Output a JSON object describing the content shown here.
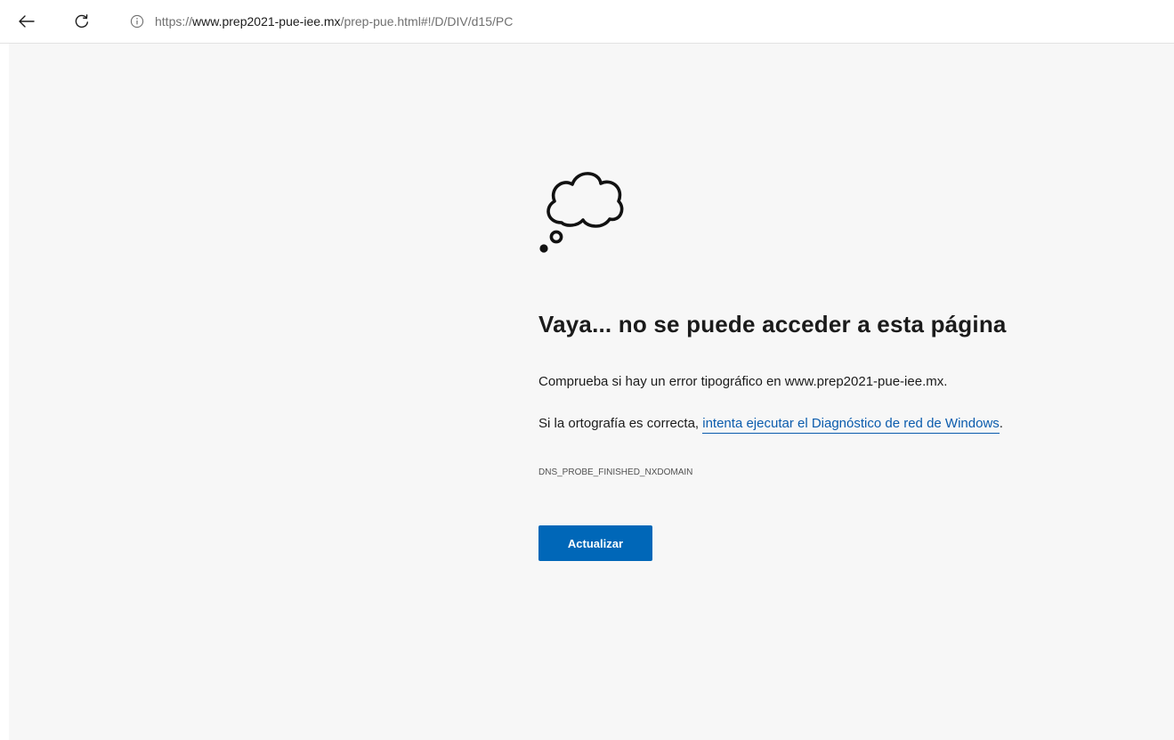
{
  "browser": {
    "back_icon": "arrow-left-icon",
    "refresh_icon": "refresh-icon",
    "info_icon": "info-icon",
    "url": {
      "scheme": "https://",
      "host": "www.prep2021-pue-iee.mx",
      "path": "/prep-pue.html#!/D/DIV/d15/PC"
    }
  },
  "error_page": {
    "icon": "thought-cloud-icon",
    "title": "Vaya... no se puede acceder a esta página",
    "typo_message": "Comprueba si hay un error tipográfico en www.prep2021-pue-iee.mx.",
    "spelling_prefix": "Si la ortografía es correcta, ",
    "diagnostic_link": "intenta ejecutar el Diagnóstico de red de Windows",
    "spelling_suffix": ".",
    "error_code": "DNS_PROBE_FINISHED_NXDOMAIN",
    "refresh_button": "Actualizar"
  },
  "colors": {
    "page_background": "#f7f7f7",
    "link": "#0b5cad",
    "button": "#0067b8",
    "text": "#1b1b1b"
  }
}
